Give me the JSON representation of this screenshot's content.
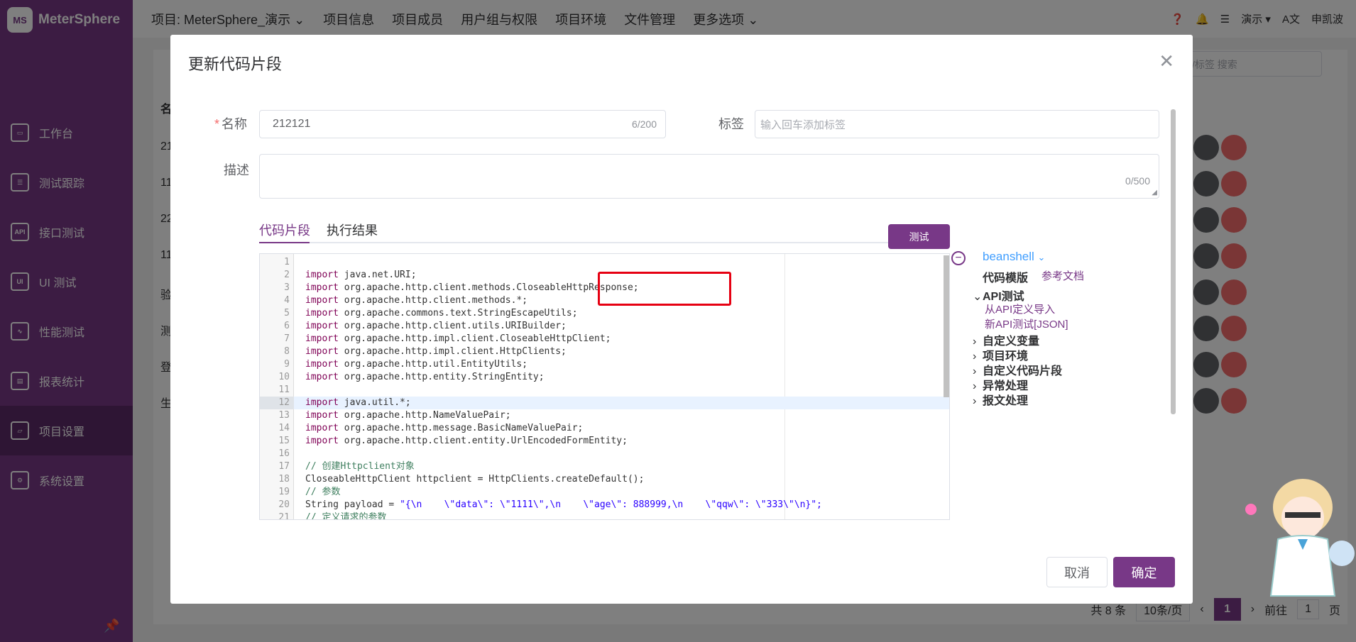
{
  "app": {
    "logo_mark": "MS",
    "name": "MeterSphere"
  },
  "sidebar": {
    "items": [
      {
        "label": "工作台",
        "icon": "monitor-icon",
        "glyph": "▭"
      },
      {
        "label": "测试跟踪",
        "icon": "clipboard-icon",
        "glyph": "☰"
      },
      {
        "label": "接口测试",
        "icon": "api-icon",
        "glyph": "API"
      },
      {
        "label": "UI 测试",
        "icon": "ui-icon",
        "glyph": "UI"
      },
      {
        "label": "性能测试",
        "icon": "chart-icon",
        "glyph": "∿"
      },
      {
        "label": "报表统计",
        "icon": "report-icon",
        "glyph": "▤"
      },
      {
        "label": "项目设置",
        "icon": "folder-settings-icon",
        "glyph": "▱"
      },
      {
        "label": "系统设置",
        "icon": "gears-icon",
        "glyph": "⚙"
      }
    ],
    "active_index": 6
  },
  "topbar": {
    "project": "项目: MeterSphere_演示",
    "menu": [
      "项目信息",
      "项目成员",
      "用户组与权限",
      "项目环境",
      "文件管理",
      "更多选项"
    ],
    "workspace": "演示",
    "user": "申凯波"
  },
  "background_list": {
    "search_placeholder": "/标签 搜索",
    "header_first": "名",
    "row_prefixes": [
      "21",
      "11",
      "22",
      "11",
      "验",
      "测",
      "登",
      "生"
    ]
  },
  "pager": {
    "total": "共 8 条",
    "page_size": "10条/页",
    "current": "1",
    "goto_label": "前往",
    "goto_value": "1",
    "page_unit": "页"
  },
  "dialog": {
    "title": "更新代码片段",
    "name_label": "名称",
    "name_value": "212121",
    "name_count": "6/200",
    "tags_label": "标签",
    "tags_placeholder": "输入回车添加标签",
    "desc_label": "描述",
    "desc_count": "0/500",
    "tabs": [
      "代码片段",
      "执行结果"
    ],
    "test_button": "测试",
    "cancel_button": "取消",
    "confirm_button": "确定"
  },
  "editor": {
    "highlighted_line": 12,
    "lines": [
      {
        "n": "1",
        "kw": "",
        "rest": ""
      },
      {
        "n": "2",
        "kw": "import",
        "rest": " java.net.URI;"
      },
      {
        "n": "3",
        "kw": "import",
        "rest": " org.apache.http.client.methods.CloseableHttpResponse;"
      },
      {
        "n": "4",
        "kw": "import",
        "rest": " org.apache.http.client.methods.*;"
      },
      {
        "n": "5",
        "kw": "import",
        "rest": " org.apache.commons.text.StringEscapeUtils;"
      },
      {
        "n": "6",
        "kw": "import",
        "rest": " org.apache.http.client.utils.URIBuilder;"
      },
      {
        "n": "7",
        "kw": "import",
        "rest": " org.apache.http.impl.client.CloseableHttpClient;"
      },
      {
        "n": "8",
        "kw": "import",
        "rest": " org.apache.http.impl.client.HttpClients;"
      },
      {
        "n": "9",
        "kw": "import",
        "rest": " org.apache.http.util.EntityUtils;"
      },
      {
        "n": "10",
        "kw": "import",
        "rest": " org.apache.http.entity.StringEntity;"
      },
      {
        "n": "11",
        "kw": "",
        "rest": ""
      },
      {
        "n": "12",
        "kw": "import",
        "rest": " java.util.*;"
      },
      {
        "n": "13",
        "kw": "import",
        "rest": " org.apache.http.NameValuePair;"
      },
      {
        "n": "14",
        "kw": "import",
        "rest": " org.apache.http.message.BasicNameValuePair;"
      },
      {
        "n": "15",
        "kw": "import",
        "rest": " org.apache.http.client.entity.UrlEncodedFormEntity;"
      },
      {
        "n": "16",
        "kw": "",
        "rest": ""
      },
      {
        "n": "17",
        "cm": "// 创建Httpclient对象"
      },
      {
        "n": "18",
        "kw": "",
        "rest": "CloseableHttpClient httpclient = HttpClients.createDefault();"
      },
      {
        "n": "19",
        "cm": "// 参数"
      },
      {
        "n": "20",
        "kw": "",
        "rest": "String payload = ",
        "str": "\"{\\n    \\\"data\\\": \\\"1111\\\",\\n    \\\"age\\\": 888999,\\n    \\\"qqw\\\": \\\"333\\\"\\n}\";"
      },
      {
        "n": "21",
        "cm": "// 定义请求的参数"
      }
    ]
  },
  "snippet_tree": {
    "language": "beanshell",
    "template_label": "代码模版",
    "doc_link": "参考文档",
    "groups": [
      {
        "label": "API测试",
        "expanded": true,
        "children": [
          "从API定义导入",
          "新API测试[JSON]"
        ]
      },
      {
        "label": "自定义变量",
        "expanded": false,
        "children": []
      },
      {
        "label": "项目环境",
        "expanded": false,
        "children": []
      },
      {
        "label": "自定义代码片段",
        "expanded": false,
        "children": []
      },
      {
        "label": "异常处理",
        "expanded": false,
        "children": []
      },
      {
        "label": "报文处理",
        "expanded": false,
        "children": []
      }
    ]
  },
  "colors": {
    "brand": "#783887",
    "danger": "#f56c6c",
    "annotation": "#e60012",
    "link": "#409eff"
  }
}
